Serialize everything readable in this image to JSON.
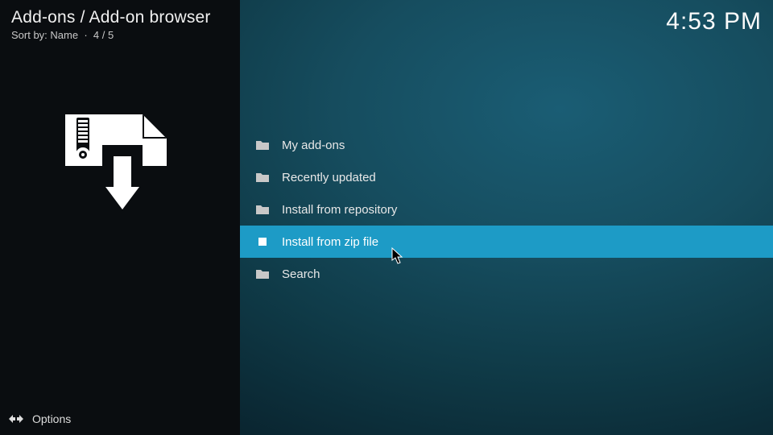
{
  "header": {
    "breadcrumb": "Add-ons / Add-on browser",
    "sort_label": "Sort by: Name",
    "position": "4 / 5",
    "clock": "4:53 PM"
  },
  "menu": {
    "items": [
      {
        "label": "My add-ons",
        "selected": false
      },
      {
        "label": "Recently updated",
        "selected": false
      },
      {
        "label": "Install from repository",
        "selected": false
      },
      {
        "label": "Install from zip file",
        "selected": true
      },
      {
        "label": "Search",
        "selected": false
      }
    ]
  },
  "footer": {
    "options_label": "Options"
  },
  "colors": {
    "highlight": "#1d9bc6",
    "sidebar_bg": "#0a0d10"
  }
}
